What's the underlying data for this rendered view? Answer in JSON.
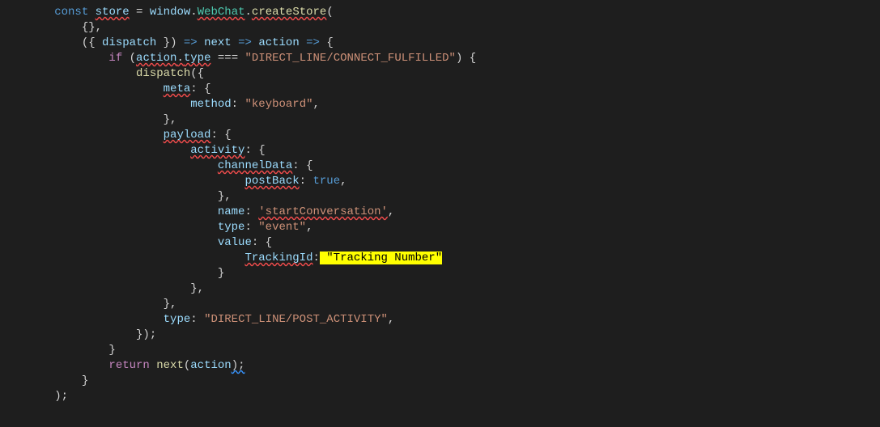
{
  "code": {
    "kw_const": "const",
    "var_store": "store",
    "eq": " = ",
    "var_window": "window",
    "cls_webchat": "WebChat",
    "fn_createStore": "createStore",
    "open_paren": "(",
    "close_paren": ")",
    "empty_obj": "{}",
    "comma": ",",
    "destruct_open": "({ ",
    "var_dispatch": "dispatch",
    "destruct_close": " })",
    "arrow": " => ",
    "var_next": "next",
    "var_action": "action",
    "brace_open": "{",
    "brace_close": "}",
    "kw_if": "if",
    "dot": ".",
    "prop_type": "type",
    "triple_eq": " === ",
    "str_connect": "\"DIRECT_LINE/CONNECT_FULFILLED\"",
    "fn_dispatch": "dispatch",
    "prop_meta": "meta",
    "colon_sp": ": ",
    "prop_method": "method",
    "str_keyboard": "\"keyboard\"",
    "prop_payload": "payload",
    "prop_activity": "activity",
    "prop_channelData": "channelData",
    "prop_postBack": "postBack",
    "kw_true": "true",
    "prop_name": "name",
    "str_startConv": "'startConversation'",
    "prop_type2": "type",
    "str_event": "\"event\"",
    "prop_value": "value",
    "prop_tracking": "TrackingId",
    "str_tracking_hl": " \"Tracking Number\"",
    "str_post": "\"DIRECT_LINE/POST_ACTIVITY\"",
    "close_call": "});",
    "kw_return": "return",
    "fn_next": "next",
    "close_stmt_semi": ");",
    "semi": ";",
    "close_paren_semi": ");",
    "underline_tail": ";"
  }
}
